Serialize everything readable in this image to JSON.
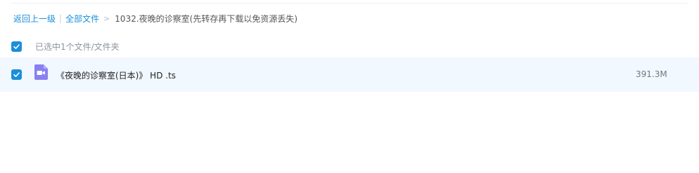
{
  "breadcrumb": {
    "back_label": "返回上一级",
    "separator": "|",
    "root_label": "全部文件",
    "arrow": ">",
    "current_folder": "1032.夜晚的诊察室(先转存再下载以免资源丢失)"
  },
  "selection": {
    "checked": true,
    "status_text": "已选中1个文件/文件夹"
  },
  "files": [
    {
      "checked": true,
      "icon": "video-file-icon",
      "name": "《夜晚的诊察室(日本)》 HD .ts",
      "size": "391.3M"
    }
  ],
  "colors": {
    "accent": "#1b8fd9",
    "row_highlight": "#f1f8ff",
    "video_icon": "#8a80f0"
  }
}
